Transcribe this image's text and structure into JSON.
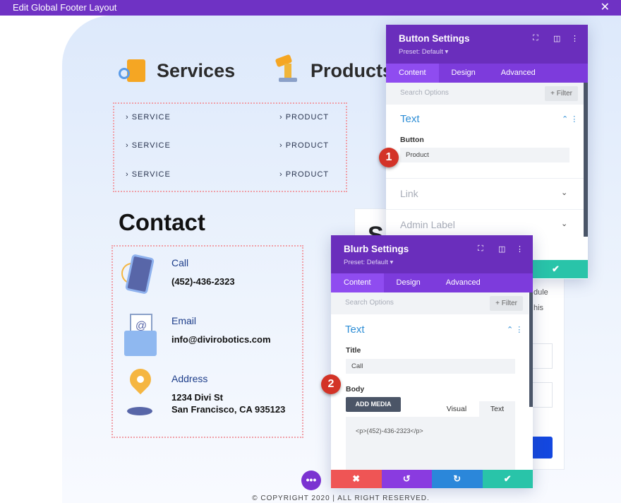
{
  "window": {
    "title": "Edit Global Footer Layout"
  },
  "footer": {
    "services": {
      "title": "Services",
      "links": [
        "› SERVICE",
        "› SERVICE",
        "› SERVICE"
      ]
    },
    "products": {
      "title": "Products",
      "links": [
        "› PRODUCT",
        "› PRODUCT",
        "› PRODUCT"
      ]
    },
    "contact": {
      "title": "Contact",
      "items": [
        {
          "title": "Call",
          "body": "(452)-436-2323"
        },
        {
          "title": "Email",
          "body": "info@divirobotics.com"
        },
        {
          "title": "Address",
          "body": "1234 Divi St",
          "body2": "San Francisco, CA 935123"
        }
      ]
    },
    "copyright": "© COPYRIGHT 2020 | ALL RIGHT RESERVED.",
    "behind": {
      "heading": "S",
      "t1": "dule",
      "t2": "his"
    }
  },
  "button_settings": {
    "title": "Button Settings",
    "preset": "Preset: Default ▾",
    "tabs": [
      "Content",
      "Design",
      "Advanced"
    ],
    "search_placeholder": "Search Options",
    "filter": "+ Filter",
    "section": "Text",
    "field_label": "Button",
    "field_value": "Product",
    "link": "Link",
    "admin": "Admin Label",
    "badge": "1"
  },
  "blurb_settings": {
    "title": "Blurb Settings",
    "preset": "Preset: Default ▾",
    "tabs": [
      "Content",
      "Design",
      "Advanced"
    ],
    "search_placeholder": "Search Options",
    "filter": "+ Filter",
    "section": "Text",
    "title_label": "Title",
    "title_value": "Call",
    "body_label": "Body",
    "add_media": "ADD MEDIA",
    "visual": "Visual",
    "text": "Text",
    "body_value": "<p>(452)-436-2323</p>",
    "badge": "2"
  },
  "colors": {
    "purple": "#6a2ebc",
    "green": "#29c4a9",
    "red": "#ef5555",
    "blue": "#2b87da"
  }
}
